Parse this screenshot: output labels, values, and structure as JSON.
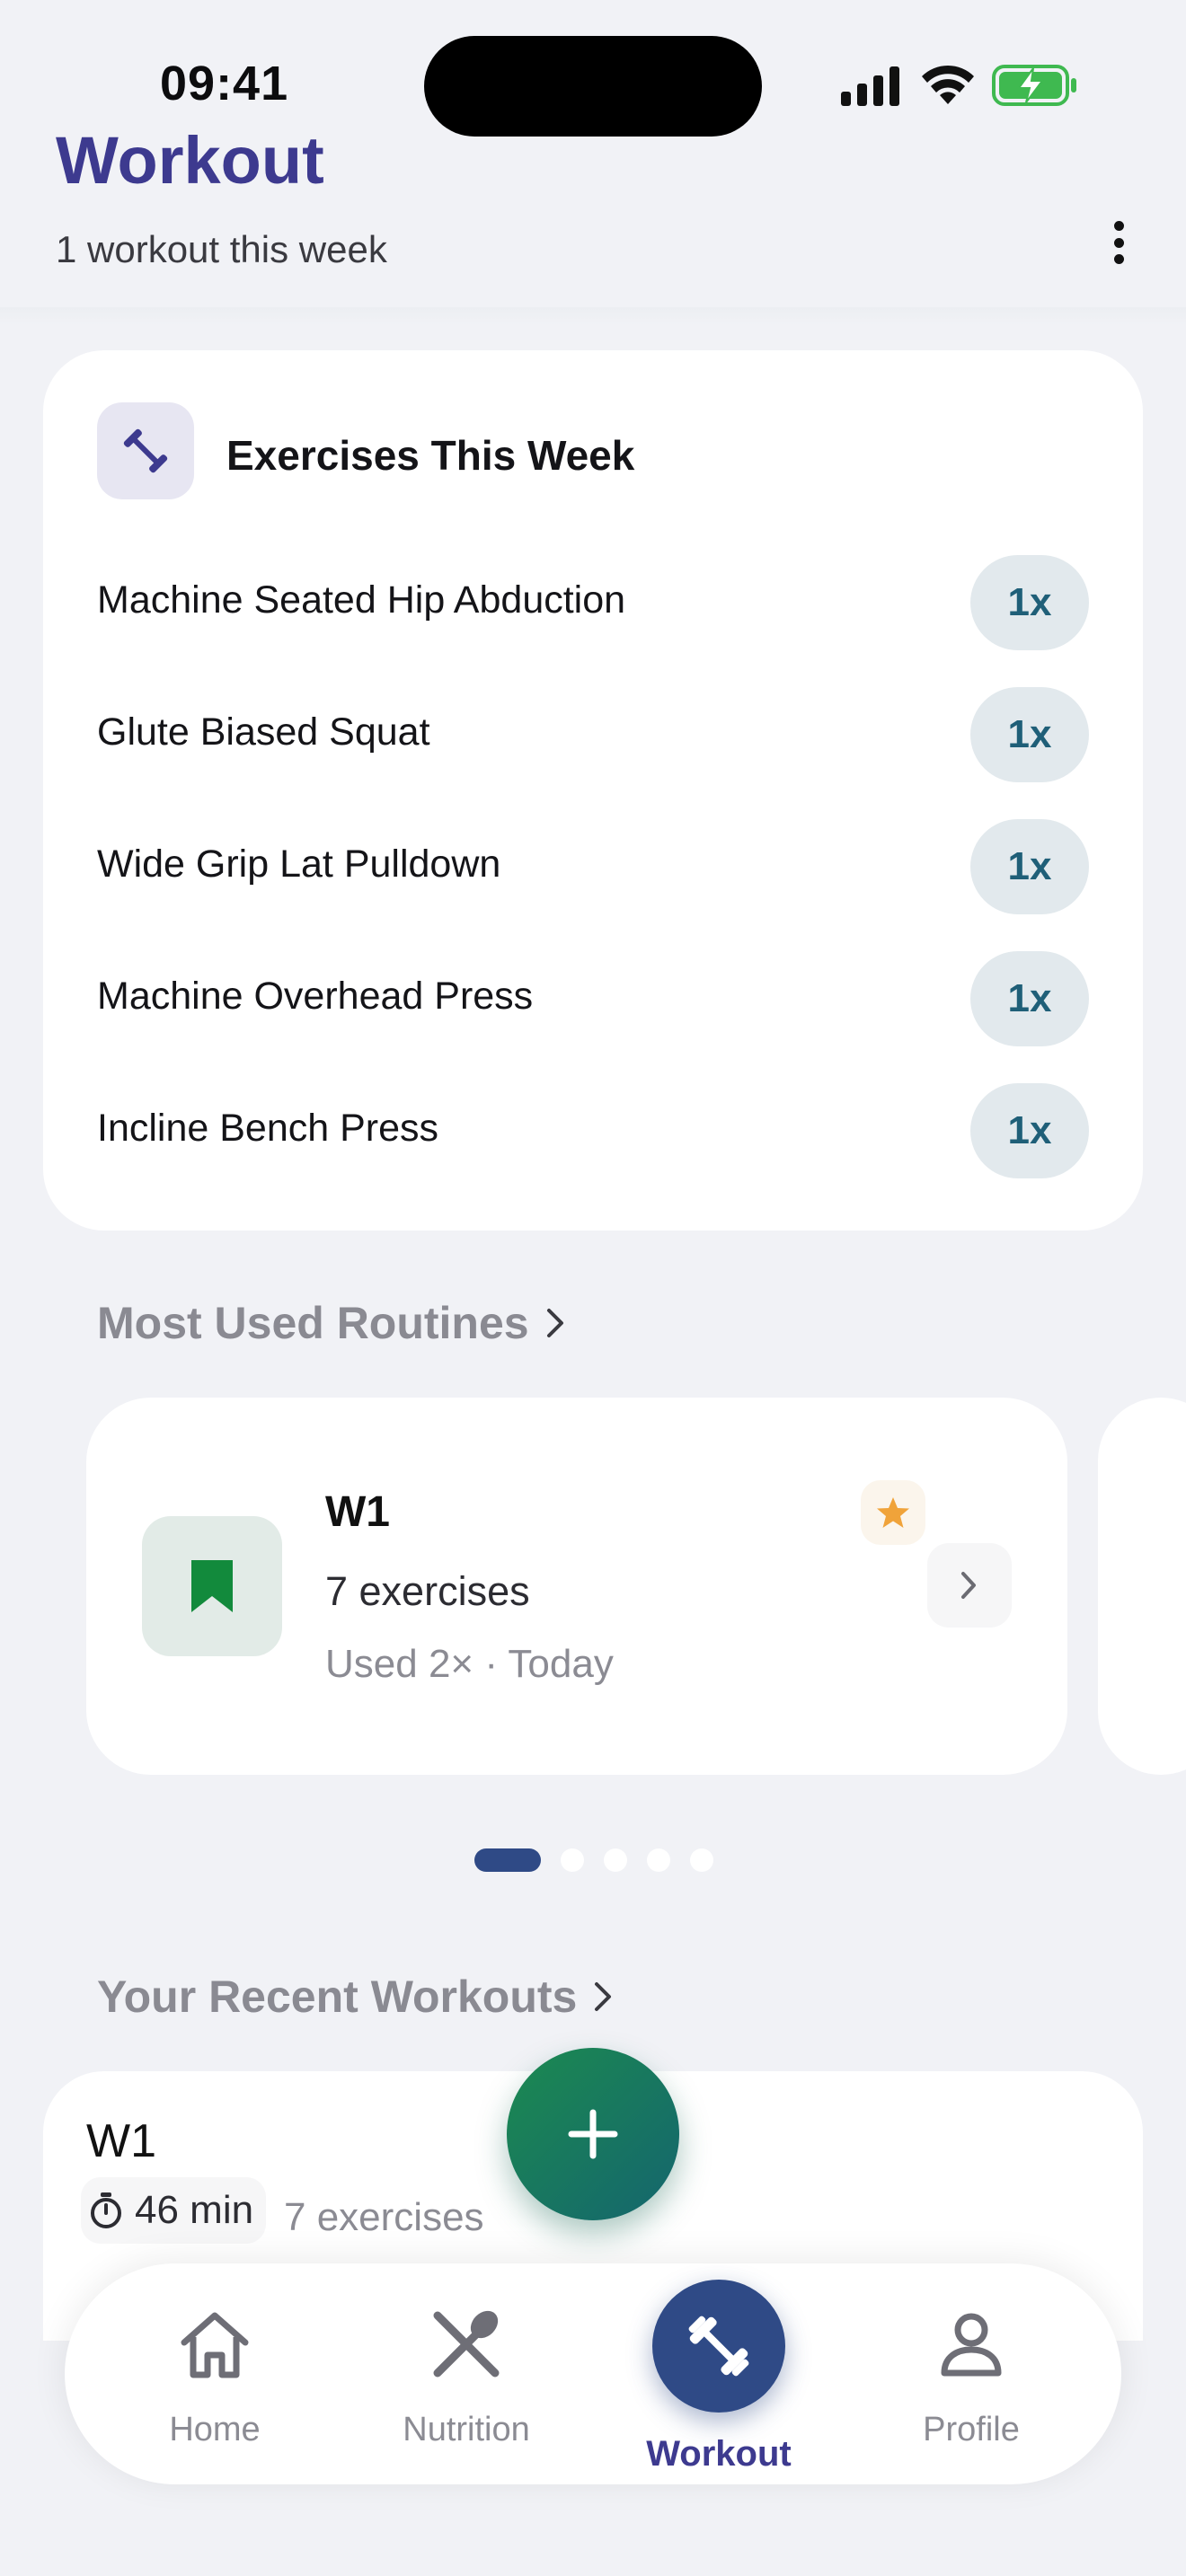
{
  "status_bar": {
    "time": "09:41"
  },
  "header": {
    "title": "Workout",
    "subtitle": "1 workout this week"
  },
  "exercises_card": {
    "title": "Exercises This Week",
    "items": [
      {
        "name": "Machine Seated Hip Abduction",
        "count": "1x"
      },
      {
        "name": "Glute Biased Squat",
        "count": "1x"
      },
      {
        "name": "Wide Grip Lat Pulldown",
        "count": "1x"
      },
      {
        "name": "Machine Overhead Press",
        "count": "1x"
      },
      {
        "name": "Incline Bench Press",
        "count": "1x"
      }
    ]
  },
  "routines": {
    "section_title": "Most Used Routines",
    "card": {
      "name": "W1",
      "exercises": "7 exercises",
      "usage": "Used 2× · Today",
      "starred": true
    },
    "pager": {
      "total": 5,
      "active": 0
    }
  },
  "recent": {
    "section_title": "Your Recent Workouts",
    "card": {
      "name": "W1",
      "duration": "46 min",
      "exercises": "7 exercises"
    }
  },
  "tabs": [
    {
      "label": "Home",
      "icon": "home-icon"
    },
    {
      "label": "Nutrition",
      "icon": "fork-spoon-icon"
    },
    {
      "label": "Workout",
      "icon": "dumbbell-icon",
      "active": true
    },
    {
      "label": "Profile",
      "icon": "person-icon"
    }
  ],
  "colors": {
    "accent": "#3d3a8f",
    "primary_blue": "#2f4a86",
    "fab_green": "#1c8a50",
    "badge_text": "#1f5f78",
    "star": "#f0a33a"
  }
}
